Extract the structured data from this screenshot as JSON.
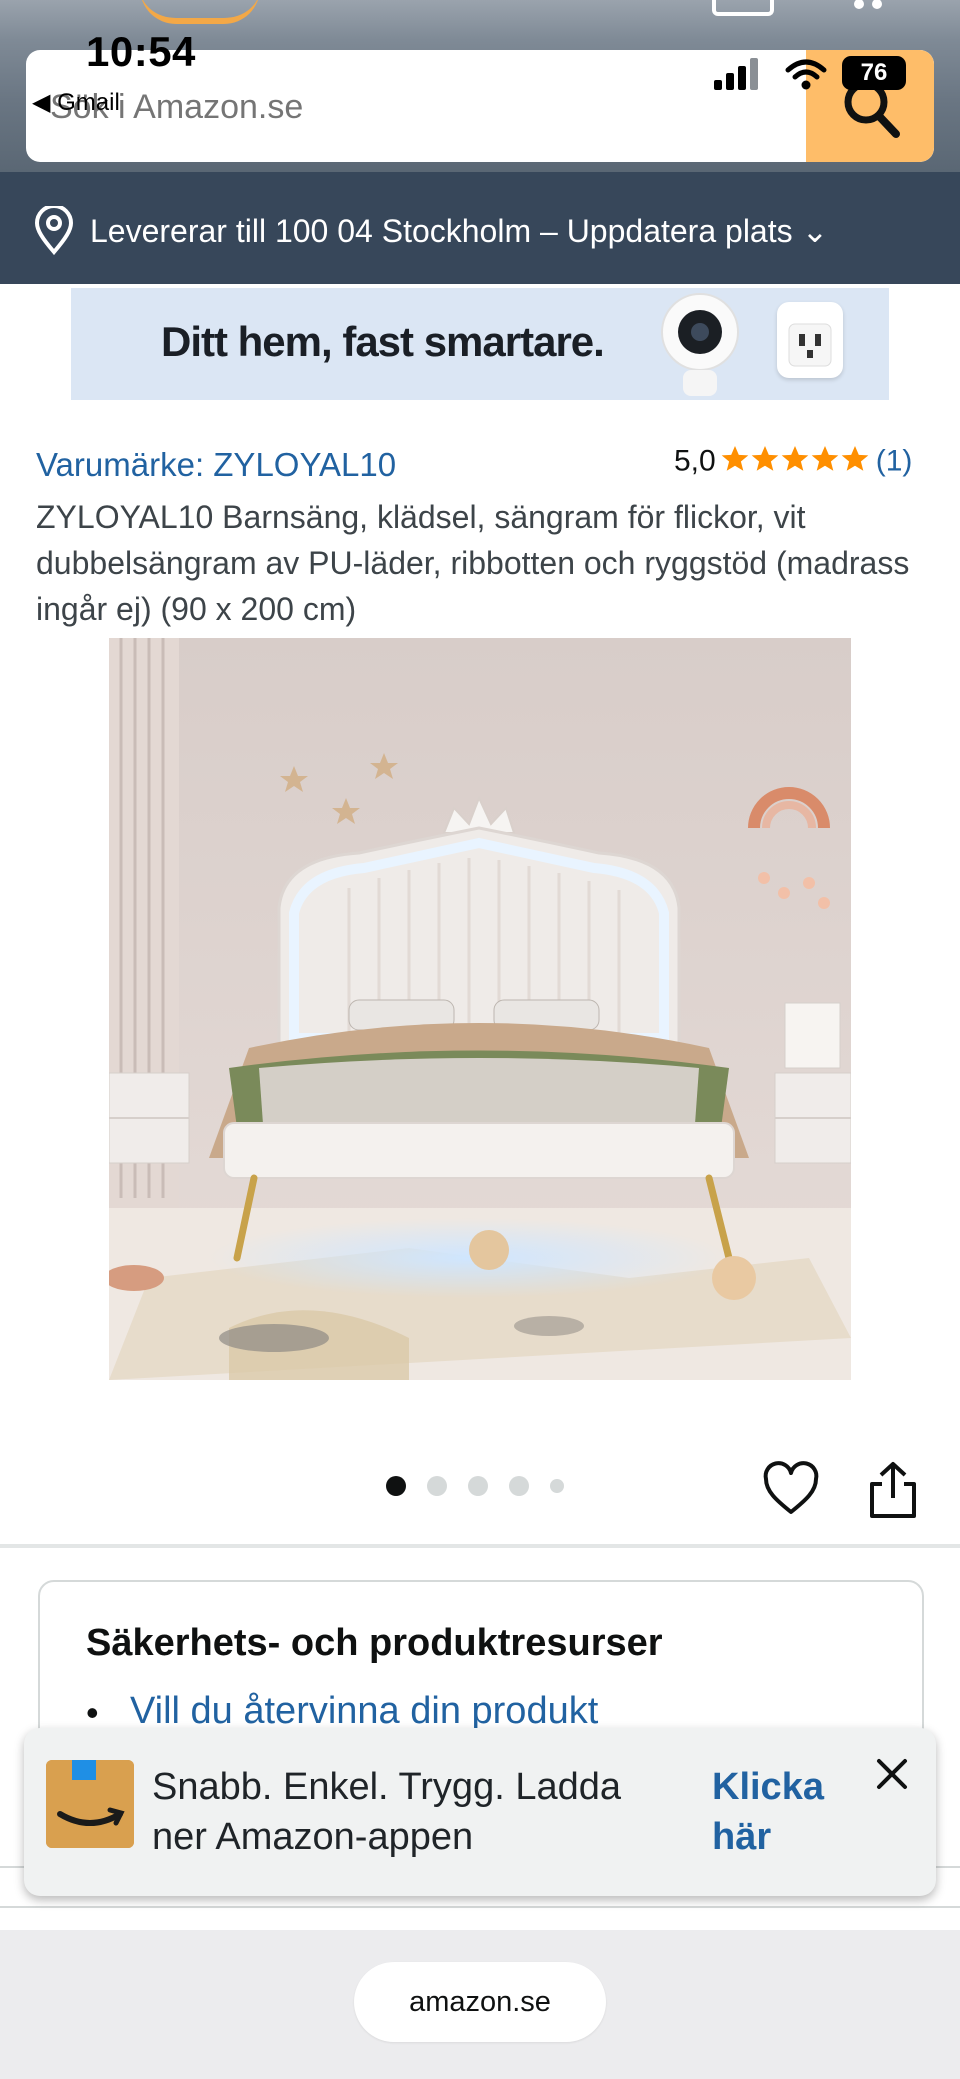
{
  "status_bar": {
    "time": "10:54",
    "back_app": "◀ Gmail",
    "battery": "76"
  },
  "search": {
    "placeholder": "Sök i Amazon.se"
  },
  "location": {
    "text": "Levererar till 100 04 Stockholm – Uppdatera plats ⌄"
  },
  "banner": {
    "text": "Ditt hem, fast smartare."
  },
  "product": {
    "brand": "Varumärke: ZYLOYAL10",
    "rating": "5,0",
    "review_count": "(1)",
    "title": "ZYLOYAL10 Barnsäng, klädsel, sängram för flickor, vit dubbelsängram av PU-läder, ribbotten och ryggstöd (madrass ingår ej) (90 x 200 cm)"
  },
  "carousel": {
    "count": 5,
    "active_index": 0
  },
  "safety": {
    "title": "Säkerhets- och produktresurser",
    "link": "Vill du återvinna din produkt"
  },
  "app_promo": {
    "text": "Snabb. Enkel. Trygg. Ladda ner Amazon-appen",
    "link": "Klicka här"
  },
  "browser": {
    "url": "amazon.se"
  },
  "colors": {
    "star": "#ff8f00",
    "link": "#2162a1",
    "search_button": "#febd69",
    "location_bar": "#37475a"
  }
}
